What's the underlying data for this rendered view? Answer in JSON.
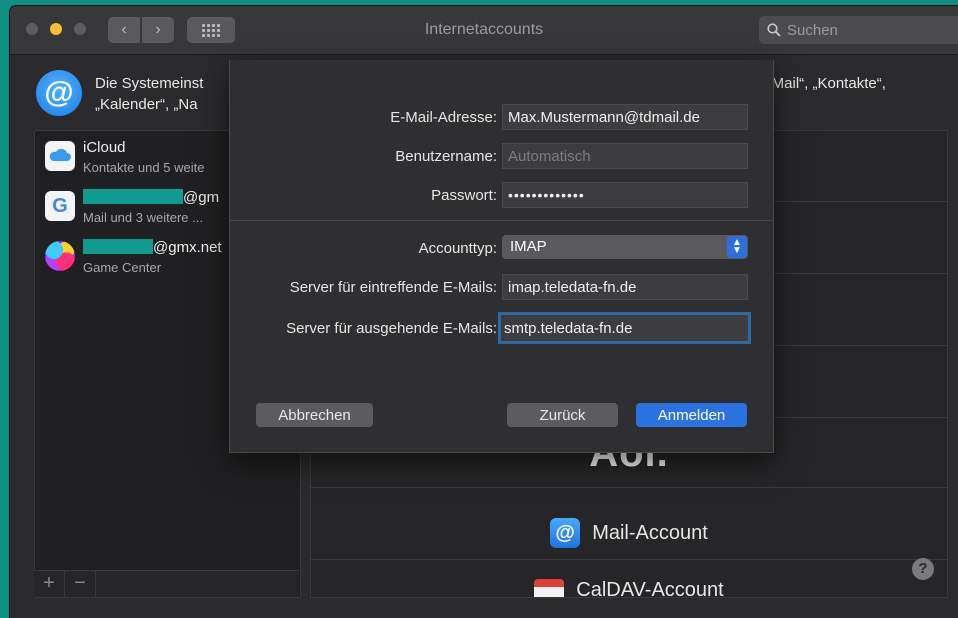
{
  "window": {
    "title": "Internetaccounts",
    "search_placeholder": "Suchen"
  },
  "header": {
    "line1_start": "Die Systemeinst",
    "line1_end": "it „Mail“, „Kontakte“,",
    "line2": "„Kalender“, „Na"
  },
  "accounts": [
    {
      "name": "iCloud",
      "sub": "Kontakte und 5 weite",
      "icon": "icloud-icon"
    },
    {
      "name_suffix": "@gm",
      "sub": "Mail und 3 weitere ...",
      "icon": "google-icon"
    },
    {
      "name_suffix": "@gmx.net",
      "sub": "Game Center",
      "icon": "game-center-icon"
    }
  ],
  "sidebar_controls": {
    "add": "+",
    "remove": "−"
  },
  "providers": {
    "aol": "Aol.",
    "mail_account": "Mail-Account",
    "caldav_account": "CalDAV-Account"
  },
  "help": "?",
  "sheet": {
    "email_label": "E-Mail-Adresse:",
    "email_value": "Max.Mustermann@tdmail.de",
    "username_label": "Benutzername:",
    "username_placeholder": "Automatisch",
    "password_label": "Passwort:",
    "password_value": "•••••••••••••",
    "account_type_label": "Accounttyp:",
    "account_type_value": "IMAP",
    "incoming_label": "Server für eintreffende E-Mails:",
    "incoming_value": "imap.teledata-fn.de",
    "outgoing_label": "Server für ausgehende E-Mails:",
    "outgoing_value": "smtp.teledata-fn.de",
    "cancel_label": "Abbrechen",
    "back_label": "Zurück",
    "signin_label": "Anmelden"
  },
  "colors": {
    "accent": "#2a72e0",
    "desktop": "#0f8f84"
  }
}
